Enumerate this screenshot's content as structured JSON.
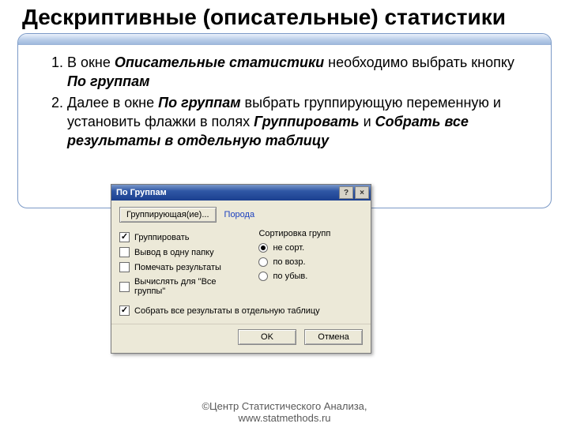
{
  "slide": {
    "title": "Дескриптивные (описательные) статистики"
  },
  "steps": {
    "s1_pre": "В  окне ",
    "s1_em1": "Описательные статистики",
    "s1_mid": " необходимо выбрать кнопку ",
    "s1_em2": "По группам",
    "s2_pre": "Далее в окне ",
    "s2_em1": "По группам",
    "s2_mid": " выбрать группирующую переменную и установить флажки в полях ",
    "s2_em2": "Группировать",
    "s2_and": " и ",
    "s2_em3": "Собрать все результаты в отдельную таблицу"
  },
  "dialog": {
    "title": "По Группам",
    "help_glyph": "?",
    "close_glyph": "×",
    "group_var_btn": "Группирующая(ие)...",
    "group_var_value": "Порода",
    "checks": {
      "group": "Группировать",
      "one_folder": "Вывод в одну папку",
      "mark_results": "Помечать результаты",
      "compute_all": "Вычислять для \"Все группы\"",
      "collect_table": "Собрать все результаты в отдельную таблицу"
    },
    "sort": {
      "heading": "Сортировка групп",
      "none": "не сорт.",
      "asc": "по возр.",
      "desc": "по убыв."
    },
    "ok": "OK",
    "cancel": "Отмена"
  },
  "footer": {
    "line1": "©Центр Статистического Анализа,",
    "line2": "www.statmethods.ru"
  }
}
